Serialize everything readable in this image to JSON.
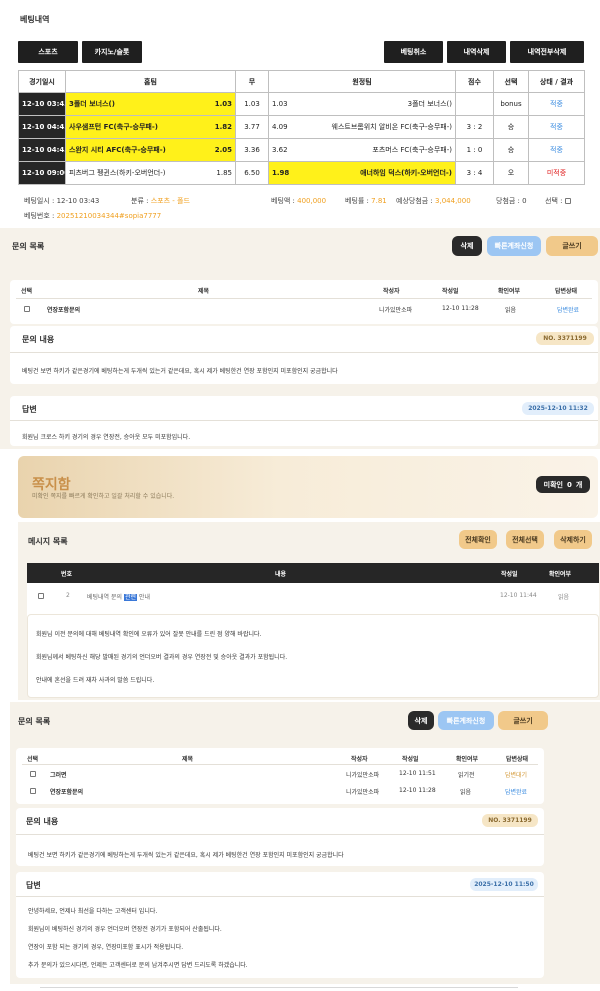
{
  "bet_history": {
    "title": "베팅내역",
    "tabs": [
      {
        "label": "스포츠"
      },
      {
        "label": "카지노/슬롯"
      }
    ],
    "actions": [
      {
        "label": "베팅취소"
      },
      {
        "label": "내역삭제"
      },
      {
        "label": "내역전부삭제"
      }
    ],
    "headers": [
      "경기일시",
      "홈팀",
      "무",
      "원정팀",
      "점수",
      "선택",
      "상태 / 결과"
    ],
    "rows": [
      {
        "date": "12-10 03:43",
        "home": "3폴더 보너스()",
        "home_odds": "1.03",
        "draw": "1.03",
        "away_odds": "1.03",
        "away": "3폴더 보너스()",
        "score": "",
        "pick": "bonus",
        "result": "적중"
      },
      {
        "date": "12-10 04:45",
        "home": "사우샘프턴 FC(축구-승무패-)",
        "home_odds": "1.82",
        "draw": "3.77",
        "away_odds": "4.09",
        "away": "웨스트브롬위치 알비온 FC(축구-승무패-)",
        "score": "3 : 2",
        "pick": "승",
        "result": "적중"
      },
      {
        "date": "12-10 04:45",
        "home": "스완지 시티 AFC(축구-승무패-)",
        "home_odds": "2.05",
        "draw": "3.36",
        "away_odds": "3.62",
        "away": "포츠머스 FC(축구-승무패-)",
        "score": "1 : 0",
        "pick": "승",
        "result": "적중"
      },
      {
        "date": "12-10 09:00",
        "home": "피츠버그 펭귄스(하키-오버언더-)",
        "home_odds": "1.85",
        "draw": "6.50",
        "away_odds": "1.98",
        "away": "애너하임 덕스(하키-오버언더-)",
        "score": "3 : 4",
        "pick": "오",
        "result": "미적중"
      }
    ],
    "info": {
      "bet_time_label": "베팅일시 :",
      "bet_time": "12-10 03:43",
      "category_label": "분류 :",
      "category": "스포츠 - 폴드",
      "amount_label": "베팅액 :",
      "amount": "400,000",
      "rate_label": "베팅률 :",
      "rate": "7.81",
      "expected_label": "예상당첨금 :",
      "expected": "3,044,000",
      "win_label": "당첨금 :",
      "win": "0",
      "select_label": "선택 :",
      "bet_no_label": "베팅번호 :",
      "bet_no": "20251210034344#sopia7777"
    }
  },
  "inquiry1": {
    "title": "문의 목록",
    "buttons": {
      "delete": "삭제",
      "quick": "빠른계좌신청",
      "write": "글쓰기"
    },
    "headers": {
      "select": "선택",
      "subject": "제목",
      "author": "작성자",
      "date": "작성일",
      "checked": "확인여부",
      "status": "답변상태"
    },
    "rows": [
      {
        "subject": "연장포함문의",
        "author": "니가있만소파",
        "date": "12-10 11:28",
        "checked": "읽음",
        "status": "답변완료"
      }
    ],
    "content_label": "문의 내용",
    "content_no": "NO. 3371199",
    "content_text": "베팅건 보면 하키가 같은경기에 베팅하는게 두개씩 있는거 같은데요, 혹시 제가 베팅한건 연장 포함인지 미포함인지 궁금합니다",
    "answer_label": "답변",
    "answer_date": "2025-12-10 11:32",
    "answer_text": "회원님 크로스 하키 경기의 경우 연장전, 승아웃 모두 미포함입니다."
  },
  "message_box": {
    "title": "쪽지함",
    "subtitle": "미확인 쪽지를 빠르게 확인하고 일괄 처리할 수 있습니다.",
    "unread_label": "미확인",
    "unread_count": "0",
    "unread_unit": "개",
    "list_title": "메시지 목록",
    "buttons": {
      "check_all": "전체확인",
      "select_all": "전체선택",
      "delete_selected": "삭제하기"
    },
    "headers": {
      "no": "번호",
      "content": "내용",
      "date": "작성일",
      "checked": "확인여부"
    },
    "row": {
      "no": "2",
      "text_before": "베팅내역 문의",
      "text_highlight": "관련",
      "text_after": "안내",
      "date": "12-10 11:44",
      "checked": "읽음"
    },
    "body_lines": [
      "회원님 이전 문의에 대해 베팅내역 확인에 오류가 있어 잘못 안내를 드린 점 양해 바랍니다.",
      "회원님께서 베팅하신 해당 발매된 경기의 언더오버 결과의 경우 연장전 및 승아웃 결과가 포함됩니다.",
      "안내에 혼선을 드려 재차 사과의 말씀 드립니다."
    ]
  },
  "inquiry2": {
    "title": "문의 목록",
    "buttons": {
      "delete": "삭제",
      "quick": "빠른계좌신청",
      "write": "글쓰기"
    },
    "headers": {
      "select": "선택",
      "subject": "제목",
      "author": "작성자",
      "date": "작성일",
      "checked": "확인여부",
      "status": "답변상태"
    },
    "rows": [
      {
        "subject": "그러면",
        "author": "니가있만소파",
        "date": "12-10 11:51",
        "checked": "읽기전",
        "status": "답변대기"
      },
      {
        "subject": "연장포함문의",
        "author": "니가있만소파",
        "date": "12-10 11:28",
        "checked": "읽음",
        "status": "답변완료"
      }
    ],
    "content_label": "문의 내용",
    "content_no": "NO. 3371199",
    "content_text": "베팅건 보면 하키가 같은경기에 베팅하는게 두개씩 있는거 같은데요, 혹시 제가 베팅한건 연장 포함인지 미포함인지 궁금합니다",
    "answer_label": "답변",
    "answer_date": "2025-12-10 11:50",
    "answer_lines": [
      "안녕하세요, 언제나 최선을 다하는 고객센터 입니다.",
      "회원님이 베팅하신 경기의 경우 언더오버 연장전 경기가 포함되어 산출됩니다.",
      "연장이 포함 되는 경기의 경우, 연장미포함 표시가 적용됩니다.",
      "추가 문의가 있으시다면, 언제든 고객센터로 문의 남겨주시면 답변 드리도록 하겠습니다."
    ]
  }
}
